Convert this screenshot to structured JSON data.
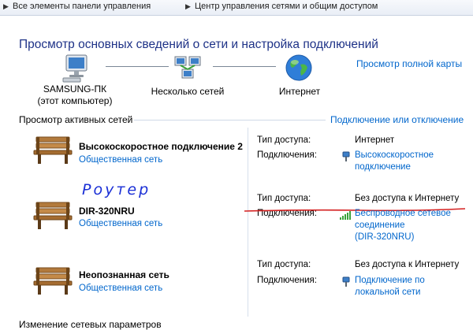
{
  "breadcrumb": {
    "items": [
      "Все элементы панели управления",
      "Центр управления сетями и общим доступом"
    ]
  },
  "page_title": "Просмотр основных сведений о сети и настройка подключений",
  "view_full_map": "Просмотр полной карты",
  "map": {
    "computer_name": "SAMSUNG-ПК",
    "computer_sub": "(этот компьютер)",
    "networks": "Несколько сетей",
    "internet": "Интернет"
  },
  "active_networks": {
    "heading": "Просмотр активных сетей",
    "connect_link": "Подключение или отключение",
    "access_label": "Тип доступа:",
    "connections_label": "Подключения:",
    "items": [
      {
        "name": "Высокоскоростное подключение 2",
        "type": "Общественная сеть",
        "access": "Интернет",
        "connection_lines": [
          "Высокоскоростное",
          "подключение"
        ]
      },
      {
        "name": "DIR-320NRU",
        "type": "Общественная сеть",
        "access": "Без доступа к Интернету",
        "connection_lines": [
          "Беспроводное сетевое",
          "соединение",
          "(DIR-320NRU)"
        ],
        "annotation": "Роутер"
      },
      {
        "name": "Неопознанная сеть",
        "type": "Общественная сеть",
        "access": "Без доступа к Интернету",
        "connection_lines": [
          "Подключение по",
          "локальной сети"
        ]
      }
    ]
  },
  "bottom_heading": "Изменение сетевых параметров",
  "colors": {
    "title": "#1e3287",
    "link": "#0066cc",
    "annotation_blue": "#1a2fd6",
    "annotation_red": "#d42020"
  }
}
